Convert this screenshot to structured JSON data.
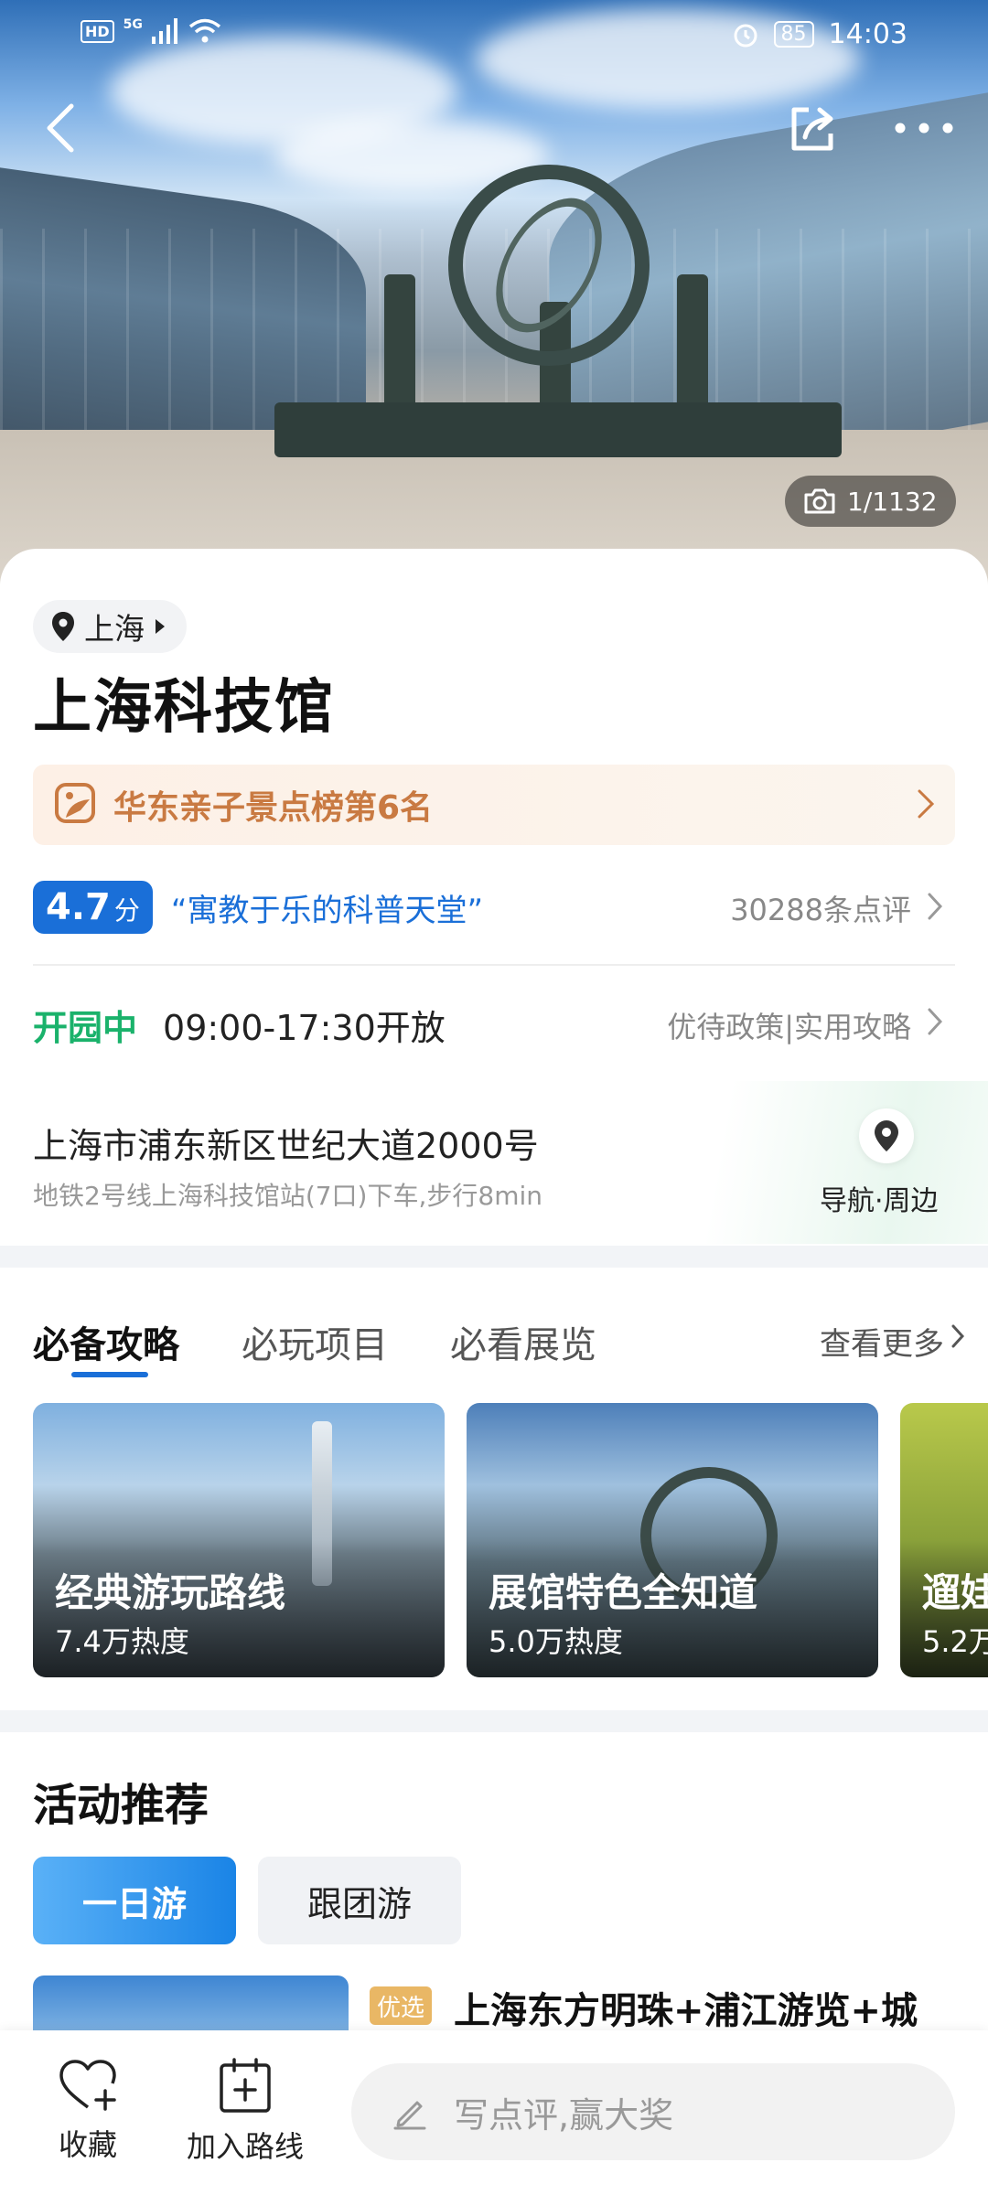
{
  "status_bar": {
    "hd": "HD",
    "network": "5G",
    "battery": "85",
    "time": "14:03"
  },
  "hero": {
    "photo_count": "1/1132"
  },
  "poi": {
    "city": "上海",
    "name": "上海科技馆",
    "rank_text": "华东亲子景点榜第6名",
    "score": "4.7",
    "score_unit": "分",
    "quote": "“寓教于乐的科普天堂”",
    "review_count": "30288条点评",
    "open_status": "开园中",
    "open_hours": "09:00-17:30开放",
    "policy_links": "优待政策|实用攻略",
    "address": "上海市浦东新区世纪大道2000号",
    "transit": "地铁2号线上海科技馆站(7口)下车,步行8min",
    "nav_label": "导航·周边"
  },
  "guide_tabs": {
    "tabs": [
      "必备攻略",
      "必玩项目",
      "必看展览"
    ],
    "see_more": "查看更多"
  },
  "guide_cards": [
    {
      "title": "经典游玩路线",
      "heat": "7.4万热度"
    },
    {
      "title": "展馆特色全知道",
      "heat": "5.0万热度"
    },
    {
      "title": "遛娃",
      "heat": "5.2万"
    }
  ],
  "activities": {
    "section_title": "活动推荐",
    "pills": [
      "一日游",
      "跟团游"
    ],
    "tag": "优选",
    "first_title": "上海东方明珠+浦江游览+城"
  },
  "bottom_bar": {
    "favorite": "收藏",
    "add_route": "加入路线",
    "review_placeholder": "写点评,赢大奖"
  },
  "colors": {
    "accent_blue": "#1a6fd8",
    "open_green": "#1ab26b",
    "rank_orange": "#c97a42"
  }
}
